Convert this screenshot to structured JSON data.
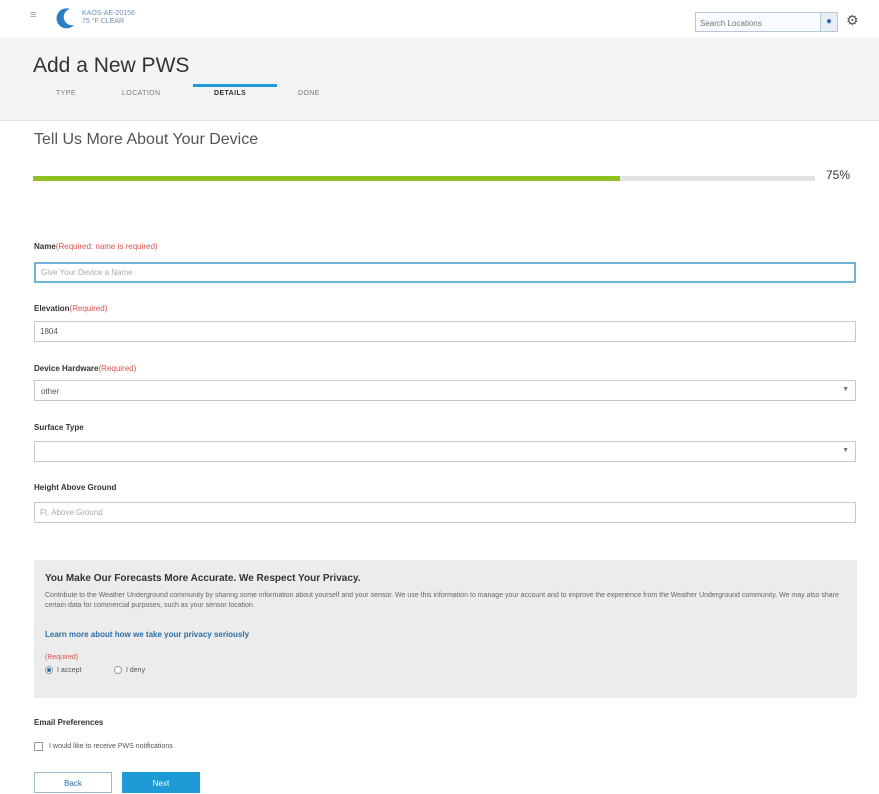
{
  "topbar": {
    "logo_text_line1": "KAOS-AE-20156",
    "logo_text_line2": "75 °F CLEAR",
    "search_placeholder": "Search Locations",
    "brand_color": "#1e9bd6"
  },
  "header": {
    "title": "Add a New PWS",
    "tabs": [
      {
        "label": "TYPE"
      },
      {
        "label": "LOCATION"
      },
      {
        "label": "DETAILS",
        "active": true
      },
      {
        "label": "DONE"
      }
    ]
  },
  "main": {
    "section_title": "Tell Us More About Your Device",
    "progress": {
      "value": 0.75,
      "label": "75%",
      "color": "#8dc020"
    }
  },
  "form": {
    "name": {
      "label": "Name",
      "required": "(Required: name is required)",
      "placeholder": "Give Your Device a Name"
    },
    "elevation": {
      "label": "Elevation",
      "required": "(Required)",
      "value": "1804"
    },
    "hardware": {
      "label": "Device Hardware",
      "required": "(Required)",
      "value": "other"
    },
    "surface": {
      "label": "Surface Type",
      "value": ""
    },
    "height": {
      "label": "Height Above Ground",
      "placeholder": "Ft. Above Ground"
    }
  },
  "privacy": {
    "title": "You Make Our Forecasts More Accurate. We Respect Your Privacy.",
    "body": "Contribute to the Weather Underground community by sharing some information about yourself and your sensor. We use this information to manage your account and to improve the experience from the Weather Underground community. We may also share certain data for commercial purposes, such as your sensor location.",
    "link": "Learn more about how we take your privacy seriously",
    "required": "(Required)",
    "options": [
      {
        "label": "I accept",
        "checked": true
      },
      {
        "label": "I deny",
        "checked": false
      }
    ]
  },
  "email": {
    "label": "Email Preferences",
    "checkbox_label": "I would like to receive PWS notifications",
    "checked": false
  },
  "buttons": {
    "back": "Back",
    "next": "Next"
  }
}
